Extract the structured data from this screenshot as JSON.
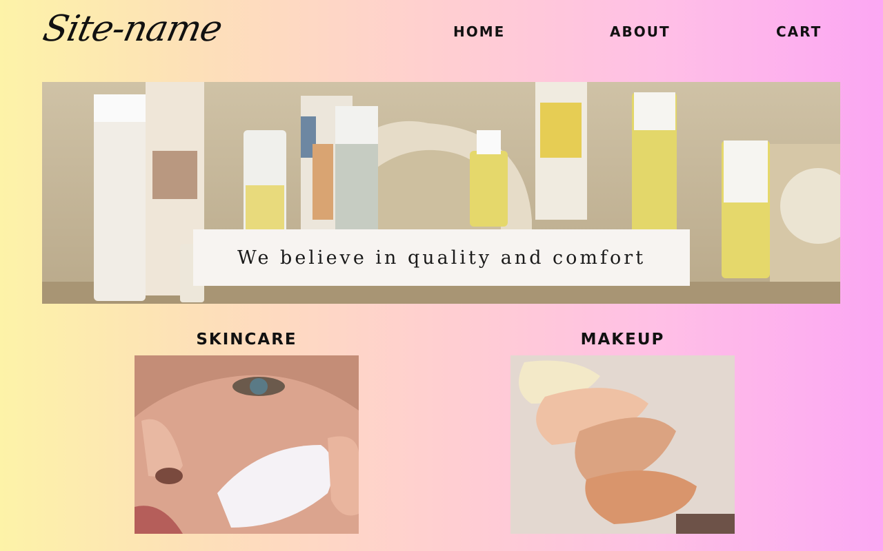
{
  "site": {
    "logo": "Site-name"
  },
  "nav": {
    "home": "HOME",
    "about": "ABOUT",
    "cart": "CART"
  },
  "hero": {
    "tagline": "We believe in quality and comfort",
    "image_alt": "skincare product bottles"
  },
  "categories": [
    {
      "label": "SKINCARE",
      "image_alt": "face with cream"
    },
    {
      "label": "MAKEUP",
      "image_alt": "foundation swatches"
    }
  ],
  "colors": {
    "gradient_start": "#fdf3a8",
    "gradient_mid": "#ffd0cf",
    "gradient_end": "#fca7f3",
    "text": "#111111"
  }
}
